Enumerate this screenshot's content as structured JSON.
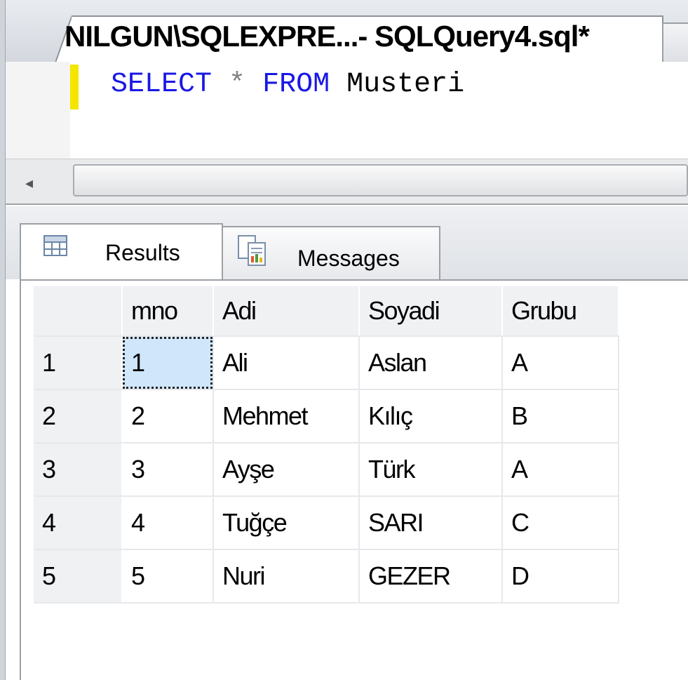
{
  "document_tab": {
    "title": "NILGUN\\SQLEXPRE...- SQLQuery4.sql*"
  },
  "editor": {
    "code": {
      "kw1": "SELECT",
      "op": "*",
      "kw2": "FROM",
      "table": "Musteri"
    }
  },
  "results_tabs": [
    {
      "label": "Results",
      "icon": "grid-icon",
      "active": true
    },
    {
      "label": "Messages",
      "icon": "messages-icon",
      "active": false
    }
  ],
  "grid": {
    "columns": [
      "",
      "mno",
      "Adi",
      "Soyadi",
      "Grubu"
    ],
    "rows": [
      [
        "1",
        "1",
        "Ali",
        "Aslan",
        "A"
      ],
      [
        "2",
        "2",
        "Mehmet",
        "Kılıç",
        "B"
      ],
      [
        "3",
        "3",
        "Ayşe",
        "Türk",
        "A"
      ],
      [
        "4",
        "4",
        "Tuğçe",
        "SARI",
        "C"
      ],
      [
        "5",
        "5",
        "Nuri",
        "GEZER",
        "D"
      ]
    ],
    "selected_cell": "1,1"
  },
  "colors": {
    "keyword": "#1818e6",
    "change_bar": "#f5e600",
    "selection": "#cfe6fb"
  }
}
